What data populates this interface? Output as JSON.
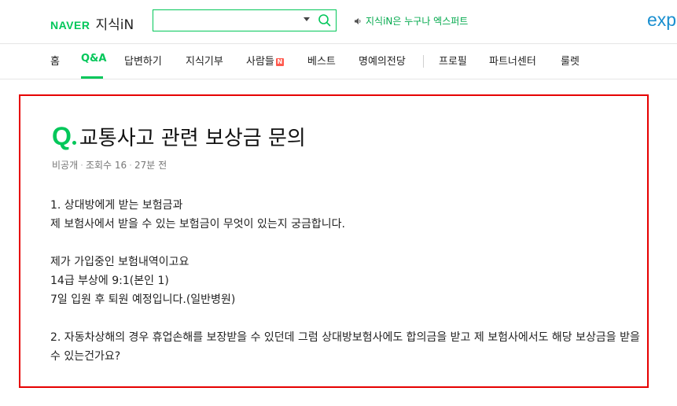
{
  "header": {
    "naver_logo": "NAVER",
    "kin_logo": "지식iN",
    "search": {
      "value": "",
      "placeholder": ""
    },
    "notice": "지식iN은 누구나 엑스퍼트",
    "expert_logo": "exp"
  },
  "nav": {
    "items": [
      {
        "label": "홈"
      },
      {
        "label": "Q&A"
      },
      {
        "label": "답변하기"
      },
      {
        "label": "지식기부"
      },
      {
        "label": "사람들",
        "badge": "N"
      },
      {
        "label": "베스트"
      },
      {
        "label": "명예의전당"
      },
      {
        "label": "프로필"
      },
      {
        "label": "파트너센터"
      },
      {
        "label": "룰렛"
      }
    ],
    "active_index": 1
  },
  "question": {
    "q_mark": "Q",
    "title": "교통사고 관련 보상금 문의",
    "author": "비공개",
    "views": "조회수 16",
    "time": "27분 전",
    "lines": [
      "1. 상대방에게 받는 보험금과",
      "제 보험사에서 받을 수 있는 보험금이 무엇이 있는지 궁금합니다.",
      "제가 가입중인 보험내역이고요",
      "14급 부상에 9:1(본인 1)",
      "7일 입원 후 퇴원 예정입니다.(일반병원)",
      "2. 자동차상해의 경우 휴업손해를 보장받을 수 있던데 그럼 상대방보험사에도 합의금을 받고 제 보험사에서도 해당 보상금을 받을 수 있는건가요?"
    ]
  },
  "colors": {
    "brand_green": "#03c75a",
    "highlight_border": "#e60000",
    "new_badge": "#ff5a4e",
    "expert_blue": "#1a8fd0"
  }
}
